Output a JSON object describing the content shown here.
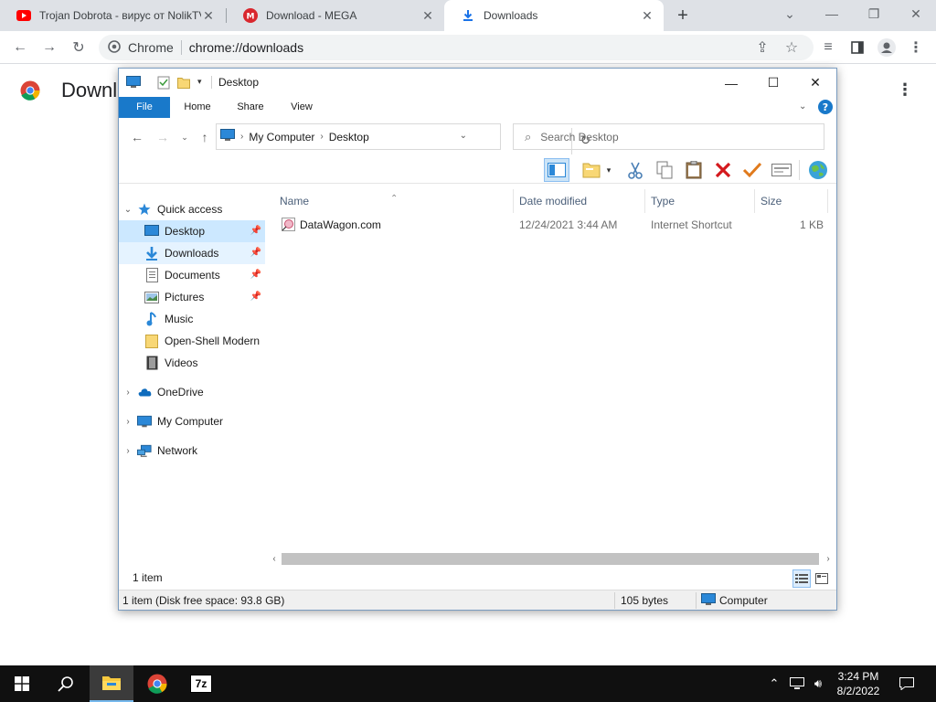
{
  "browser": {
    "tabs": [
      {
        "title": "Trojan Dobrota - вирус от NolikTV",
        "favicon": "youtube-icon"
      },
      {
        "title": "Download - MEGA",
        "favicon": "mega-icon"
      },
      {
        "title": "Downloads",
        "favicon": "download-icon",
        "active": true
      }
    ],
    "new_tab": "+",
    "omnibox": {
      "site_chip": "Chrome",
      "url": "chrome://downloads"
    },
    "page": {
      "title": "Downl"
    }
  },
  "explorer": {
    "title": "Desktop",
    "ribbon_tabs": [
      "File",
      "Home",
      "Share",
      "View"
    ],
    "address": {
      "segments": [
        "My Computer",
        "Desktop"
      ]
    },
    "search_placeholder": "Search Desktop",
    "nav_pane": {
      "quick_access": "Quick access",
      "items": [
        {
          "label": "Desktop",
          "icon": "desktop-icon",
          "pinned": true
        },
        {
          "label": "Downloads",
          "icon": "downloads-icon",
          "pinned": true
        },
        {
          "label": "Documents",
          "icon": "documents-icon",
          "pinned": true
        },
        {
          "label": "Pictures",
          "icon": "pictures-icon",
          "pinned": true
        },
        {
          "label": "Music",
          "icon": "music-icon"
        },
        {
          "label": "Open-Shell Modern",
          "icon": "folder-icon"
        },
        {
          "label": "Videos",
          "icon": "videos-icon"
        }
      ],
      "onedrive": "OneDrive",
      "my_computer": "My Computer",
      "network": "Network"
    },
    "columns": [
      "Name",
      "Date modified",
      "Type",
      "Size"
    ],
    "files": [
      {
        "name": "DataWagon.com",
        "date": "12/24/2021 3:44 AM",
        "type": "Internet Shortcut",
        "size": "1 KB"
      }
    ],
    "item_count": "1 item",
    "status": {
      "left": "1 item (Disk free space: 93.8 GB)",
      "middle": "105 bytes",
      "right": "Computer"
    }
  },
  "taskbar": {
    "clock_time": "3:24 PM",
    "clock_date": "8/2/2022",
    "items": [
      "start-icon",
      "search-icon",
      "file-explorer-icon",
      "chrome-icon",
      "7zip-icon"
    ],
    "seven_zip_label": "7z"
  },
  "colors": {
    "accent": "#1979ca",
    "selection": "#cce8ff",
    "taskbar": "#101010"
  }
}
